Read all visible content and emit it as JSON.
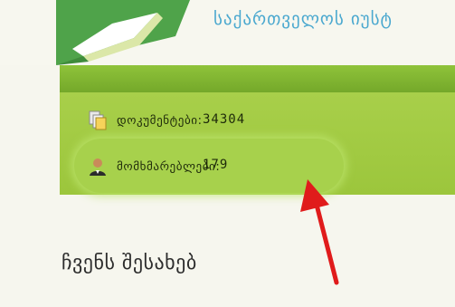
{
  "header": {
    "site_title": "საქართველოს იუსტ"
  },
  "stats": {
    "documents_label": "დოკუმენტები:",
    "documents_count": "34304",
    "users_label": "მომხმარებლები:",
    "users_count": "179"
  },
  "about": {
    "heading": "ჩვენს შესახებ"
  },
  "icons": {
    "documents": "documents-icon",
    "users": "user-icon",
    "logo": "open-book-logo"
  },
  "colors": {
    "site_title": "#4aa8cf",
    "green_panel": "#9cc63c",
    "annotation_arrow": "#e01b1b"
  }
}
